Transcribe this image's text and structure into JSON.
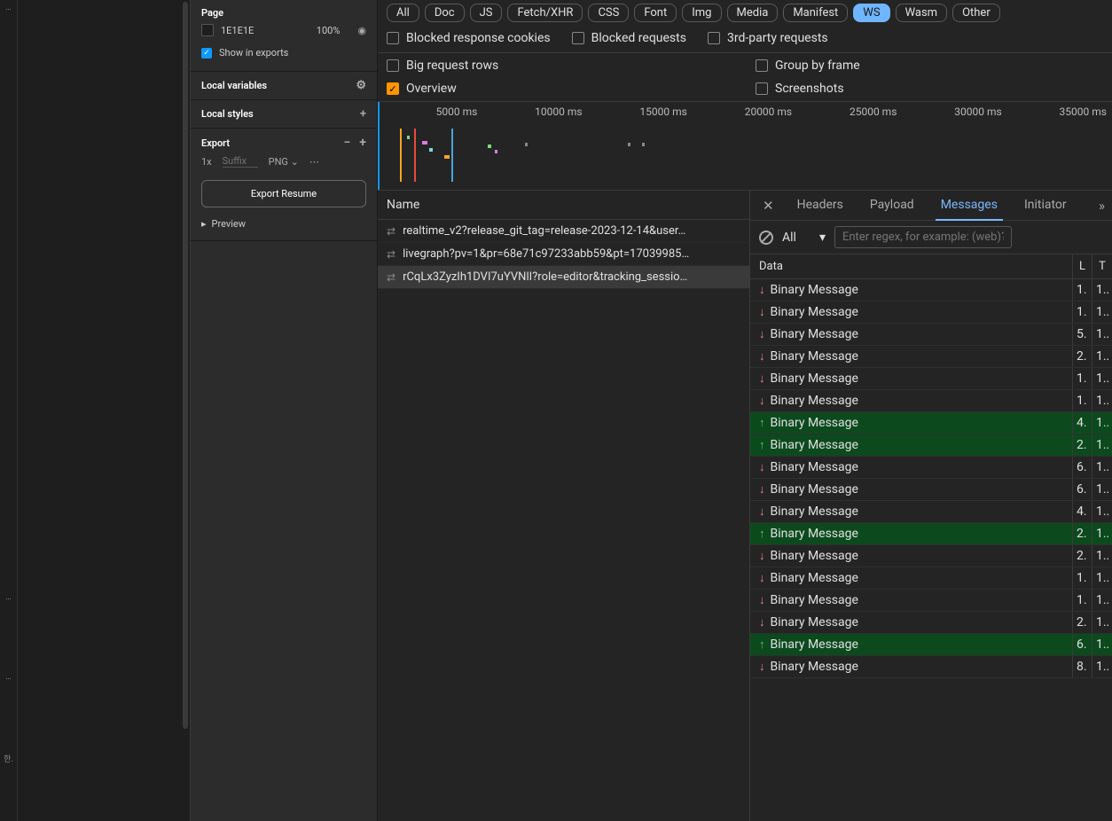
{
  "figma": {
    "page_label": "Page",
    "fill_hex": "1E1E1E",
    "fill_pct": "100%",
    "show_exports": "Show in exports",
    "local_vars": "Local variables",
    "local_styles": "Local styles",
    "export": "Export",
    "scale": "1x",
    "suffix_placeholder": "Suffix",
    "format": "PNG",
    "export_btn": "Export Resume",
    "preview": "Preview"
  },
  "filters": {
    "chips": [
      "All",
      "Doc",
      "JS",
      "Fetch/XHR",
      "CSS",
      "Font",
      "Img",
      "Media",
      "Manifest",
      "WS",
      "Wasm",
      "Other"
    ],
    "active_chip": "WS",
    "blocked_cookies": "Blocked response cookies",
    "blocked_requests": "Blocked requests",
    "third_party": "3rd-party requests",
    "big_rows": "Big request rows",
    "group_frame": "Group by frame",
    "overview": "Overview",
    "screenshots": "Screenshots"
  },
  "timeline": {
    "ticks": [
      "5000 ms",
      "10000 ms",
      "15000 ms",
      "20000 ms",
      "25000 ms",
      "30000 ms",
      "35000 ms"
    ]
  },
  "requests": {
    "header": "Name",
    "items": [
      {
        "name": "realtime_v2?release_git_tag=release-2023-12-14&user…",
        "selected": false
      },
      {
        "name": "livegraph?pv=1&pr=68e71c97233abb59&pt=17039985…",
        "selected": false
      },
      {
        "name": "rCqLx3ZyzIh1DVI7uYVNlI?role=editor&tracking_sessio…",
        "selected": true
      }
    ]
  },
  "detail": {
    "tabs": [
      "Headers",
      "Payload",
      "Messages",
      "Initiator"
    ],
    "active_tab": "Messages",
    "filter_all": "All",
    "regex_placeholder": "Enter regex, for example: (web)?socket",
    "cols": {
      "data": "Data",
      "len": "L",
      "time": "T"
    },
    "messages": [
      {
        "dir": "down",
        "text": "Binary Message",
        "len": "1.",
        "time": "1.."
      },
      {
        "dir": "down",
        "text": "Binary Message",
        "len": "1.",
        "time": "1.."
      },
      {
        "dir": "down",
        "text": "Binary Message",
        "len": "5.",
        "time": "1.."
      },
      {
        "dir": "down",
        "text": "Binary Message",
        "len": "2.",
        "time": "1.."
      },
      {
        "dir": "down",
        "text": "Binary Message",
        "len": "1.",
        "time": "1.."
      },
      {
        "dir": "down",
        "text": "Binary Message",
        "len": "1.",
        "time": "1.."
      },
      {
        "dir": "up",
        "text": "Binary Message",
        "len": "4.",
        "time": "1.."
      },
      {
        "dir": "up",
        "text": "Binary Message",
        "len": "2.",
        "time": "1.."
      },
      {
        "dir": "down",
        "text": "Binary Message",
        "len": "6.",
        "time": "1.."
      },
      {
        "dir": "down",
        "text": "Binary Message",
        "len": "6.",
        "time": "1.."
      },
      {
        "dir": "down",
        "text": "Binary Message",
        "len": "4.",
        "time": "1.."
      },
      {
        "dir": "up",
        "text": "Binary Message",
        "len": "2.",
        "time": "1.."
      },
      {
        "dir": "down",
        "text": "Binary Message",
        "len": "2.",
        "time": "1.."
      },
      {
        "dir": "down",
        "text": "Binary Message",
        "len": "1.",
        "time": "1.."
      },
      {
        "dir": "down",
        "text": "Binary Message",
        "len": "1.",
        "time": "1.."
      },
      {
        "dir": "down",
        "text": "Binary Message",
        "len": "2.",
        "time": "1.."
      },
      {
        "dir": "up",
        "text": "Binary Message",
        "len": "6.",
        "time": "1.."
      },
      {
        "dir": "down",
        "text": "Binary Message",
        "len": "8.",
        "time": "1.."
      }
    ]
  }
}
